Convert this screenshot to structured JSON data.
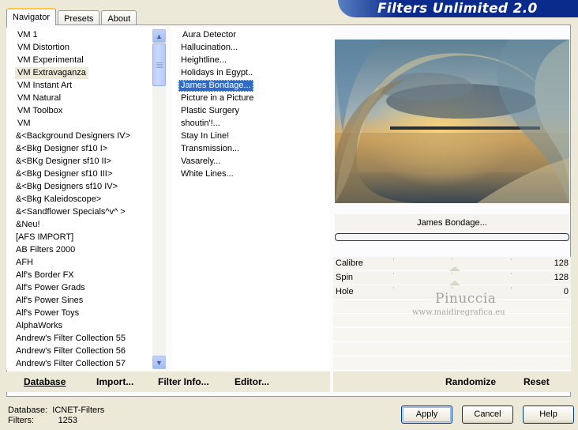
{
  "app_title": "Filters Unlimited 2.0",
  "tabs": [
    {
      "label": "Navigator",
      "active": true
    },
    {
      "label": "Presets",
      "active": false
    },
    {
      "label": "About",
      "active": false
    }
  ],
  "categories": [
    "VM 1",
    "VM Distortion",
    "VM Experimental",
    "VM Extravaganza",
    "VM Instant Art",
    "VM Natural",
    "VM Toolbox",
    "VM",
    "&<Background Designers IV>",
    "&<Bkg Designer sf10 I>",
    "&<BKg Designer sf10 II>",
    "&<Bkg Designer sf10 III>",
    "&<Bkg Designers sf10 IV>",
    "&<Bkg Kaleidoscope>",
    "&<Sandflower Specials^v^ >",
    "&Neu!",
    "[AFS IMPORT]",
    "AB Filters 2000",
    "AFH",
    "Alf's Border FX",
    "Alf's Power Grads",
    "Alf's Power Sines",
    "Alf's Power Toys",
    "AlphaWorks",
    "Andrew's Filter Collection 55",
    "Andrew's Filter Collection 56",
    "Andrew's Filter Collection 57"
  ],
  "selected_category": "VM Extravaganza",
  "filters": [
    "Aura Detector",
    "Hallucination...",
    "Heightline...",
    "Holidays in Egypt..",
    "James Bondage...",
    "Picture in a Picture",
    "Plastic Surgery",
    "shoutin'!...",
    "Stay In Line!",
    "Transmission...",
    "Vasarely...",
    "White Lines..."
  ],
  "selected_filter": "James Bondage...",
  "preview": {
    "filter_name": "James Bondage...",
    "progress": 0
  },
  "params": [
    {
      "name": "Calibre",
      "value": "128"
    },
    {
      "name": "Spin",
      "value": "128"
    },
    {
      "name": "Hole",
      "value": "0"
    }
  ],
  "watermark": {
    "name": "Pinuccia",
    "url": "www.maidiregrafica.eu"
  },
  "actions": {
    "database": "Database",
    "import": "Import...",
    "filter_info": "Filter Info...",
    "editor": "Editor...",
    "randomize": "Randomize",
    "reset": "Reset"
  },
  "status": {
    "database_label": "Database:",
    "database_value": "ICNET-Filters",
    "filters_label": "Filters:",
    "filters_value": "1253"
  },
  "buttons": {
    "apply": "Apply",
    "cancel": "Cancel",
    "help": "Help"
  }
}
